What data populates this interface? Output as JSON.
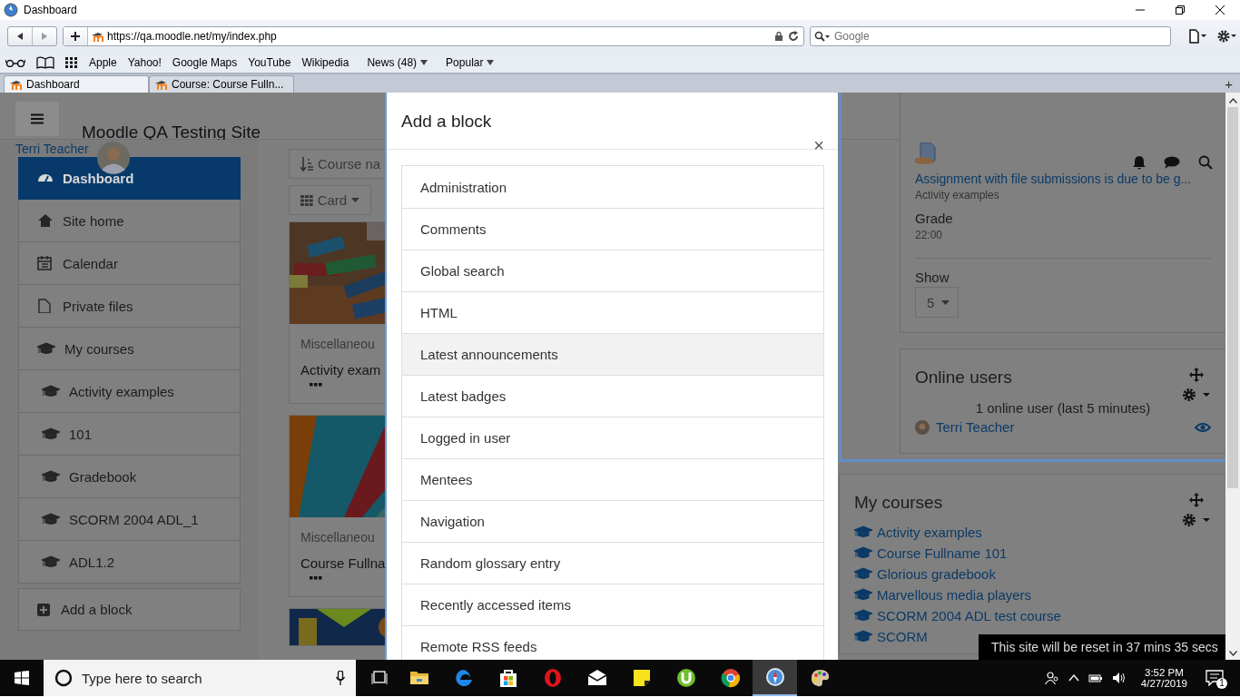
{
  "window": {
    "title": "Dashboard"
  },
  "browser": {
    "address": "https://qa.moodle.net/my/index.php",
    "search_placeholder": "Google",
    "bookmarks": [
      {
        "label": "Apple",
        "menu": false
      },
      {
        "label": "Yahoo!",
        "menu": false
      },
      {
        "label": "Google Maps",
        "menu": false
      },
      {
        "label": "YouTube",
        "menu": false
      },
      {
        "label": "Wikipedia",
        "menu": false
      },
      {
        "label": "News (48)",
        "menu": true
      },
      {
        "label": "Popular",
        "menu": true
      }
    ],
    "tabs": [
      {
        "label": "Dashboard",
        "selected": true
      },
      {
        "label": "Course: Course Fulln...",
        "selected": false
      }
    ],
    "new_tab": "+"
  },
  "page": {
    "site_name": "Moodle QA Testing Site",
    "user_name": "Terri Teacher",
    "nav": [
      {
        "label": "Dashboard",
        "kind": "dashboard",
        "selected": true
      },
      {
        "label": "Site home",
        "kind": "home",
        "selected": false
      },
      {
        "label": "Calendar",
        "kind": "calendar",
        "selected": false
      },
      {
        "label": "Private files",
        "kind": "file",
        "selected": false
      },
      {
        "label": "My courses",
        "kind": "courses",
        "selected": false,
        "children": [
          {
            "label": "Activity examples",
            "kind": "course",
            "selected": false
          },
          {
            "label": "101",
            "kind": "course",
            "selected": false
          },
          {
            "label": "Gradebook",
            "kind": "course",
            "selected": false
          },
          {
            "label": "SCORM 2004 ADL_1",
            "kind": "course",
            "selected": false
          },
          {
            "label": "ADL1.2",
            "kind": "course",
            "selected": false
          }
        ]
      }
    ],
    "add_block": "Add a block",
    "sort_button": "Course na",
    "view_button": "Card",
    "cards": [
      {
        "category": "Miscellaneou",
        "name": "Activity exam",
        "image": {
          "kind": "picture"
        }
      },
      {
        "category": "Miscellaneou",
        "name": "Course Fullna",
        "image": {
          "kind": "picture"
        }
      },
      {
        "image": {
          "kind": "picture"
        }
      }
    ],
    "timeline": {
      "event": "Assignment with file submissions is due to be g...",
      "course": "Activity examples",
      "grade_label": "Grade",
      "time": "22:00",
      "show_label": "Show",
      "show_value": "5"
    },
    "online_users": {
      "title": "Online users",
      "summary": "1 online user (last 5 minutes)",
      "users": [
        "Terri Teacher"
      ]
    },
    "my_courses": {
      "title": "My courses",
      "courses": [
        "Activity examples",
        "Course Fullname 101",
        "Glorious gradebook",
        "Marvellous media players",
        "SCORM 2004 ADL test course",
        "SCORM"
      ]
    },
    "toast": "This site will be reset in 37 mins 35 secs"
  },
  "modal": {
    "title": "Add a block",
    "close": "×",
    "items": [
      {
        "label": "Administration",
        "highlighted": false
      },
      {
        "label": "Comments",
        "highlighted": false
      },
      {
        "label": "Global search",
        "highlighted": false
      },
      {
        "label": "HTML",
        "highlighted": false
      },
      {
        "label": "Latest announcements",
        "highlighted": true
      },
      {
        "label": "Latest badges",
        "highlighted": false
      },
      {
        "label": "Logged in user",
        "highlighted": false
      },
      {
        "label": "Mentees",
        "highlighted": false
      },
      {
        "label": "Navigation",
        "highlighted": false
      },
      {
        "label": "Random glossary entry",
        "highlighted": false
      },
      {
        "label": "Recently accessed items",
        "highlighted": false
      },
      {
        "label": "Remote RSS feeds",
        "highlighted": false
      }
    ]
  },
  "taskbar": {
    "search_placeholder": "Type here to search",
    "apps": [
      {
        "kind": "folder",
        "selected": false
      },
      {
        "kind": "edge",
        "selected": false
      },
      {
        "kind": "store",
        "selected": false
      },
      {
        "kind": "opera",
        "selected": false
      },
      {
        "kind": "mail",
        "selected": false
      },
      {
        "kind": "note",
        "selected": false
      },
      {
        "kind": "torrent",
        "selected": false
      },
      {
        "kind": "chrome",
        "selected": false
      },
      {
        "kind": "compass",
        "selected": true
      },
      {
        "kind": "palette",
        "selected": false
      }
    ],
    "time": "3:52 PM",
    "date": "4/27/2019",
    "notifications": "1"
  }
}
